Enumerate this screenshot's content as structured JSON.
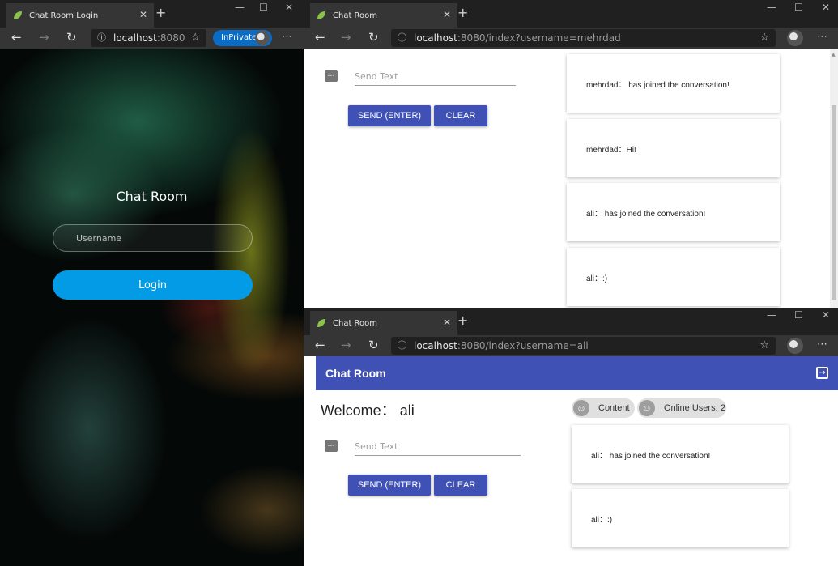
{
  "login_window": {
    "tab_title": "Chat Room Login",
    "url_host": "localhost",
    "url_port": ":8080",
    "inprivate_label": "InPrivate",
    "title": "Chat Room",
    "username_placeholder": "Username",
    "login_label": "Login"
  },
  "chat_window_mehrdad": {
    "tab_title": "Chat Room",
    "url_host": "localhost",
    "url_rest": ":8080/index?username=mehrdad",
    "send_placeholder": "Send Text",
    "send_label": "SEND (ENTER)",
    "clear_label": "CLEAR",
    "messages": [
      "mehrdad： has joined the conversation!",
      "mehrdad：Hi!",
      "ali： has joined the conversation!",
      "ali：:)"
    ]
  },
  "chat_window_ali": {
    "tab_title": "Chat Room",
    "url_host": "localhost",
    "url_rest": ":8080/index?username=ali",
    "app_title": "Chat Room",
    "welcome": "Welcome： ali",
    "chip_content": "Content",
    "chip_online_label": "Online Users:",
    "online_count": "2",
    "send_placeholder": "Send Text",
    "send_label": "SEND (ENTER)",
    "clear_label": "CLEAR",
    "messages": [
      "ali： has joined the conversation!",
      "ali：:)"
    ]
  },
  "colors": {
    "primary": "#3f51b5",
    "login_button": "#039be5",
    "inprivate_badge": "#0a6cc4"
  },
  "icons": {
    "tab_favicon": "spring-leaf-icon",
    "message": "message-icon",
    "logout": "logout-icon",
    "chip_avatar": "face-icon"
  }
}
